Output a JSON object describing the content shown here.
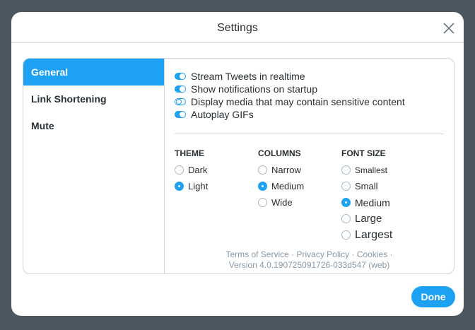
{
  "title": "Settings",
  "sidebar": {
    "items": [
      {
        "label": "General",
        "active": true
      },
      {
        "label": "Link Shortening"
      },
      {
        "label": "Mute"
      }
    ]
  },
  "toggles": [
    {
      "label": "Stream Tweets in realtime",
      "on": true
    },
    {
      "label": "Show notifications on startup",
      "on": true
    },
    {
      "label": "Display media that may contain sensitive content",
      "on": false
    },
    {
      "label": "Autoplay GIFs",
      "on": true
    }
  ],
  "theme": {
    "heading": "THEME",
    "options": [
      "Dark",
      "Light"
    ],
    "selected": "Light"
  },
  "columns": {
    "heading": "COLUMNS",
    "options": [
      "Narrow",
      "Medium",
      "Wide"
    ],
    "selected": "Medium"
  },
  "font_size": {
    "heading": "FONT SIZE",
    "options": [
      "Smallest",
      "Small",
      "Medium",
      "Large",
      "Largest"
    ],
    "selected": "Medium"
  },
  "footer": {
    "terms": "Terms of Service",
    "privacy": "Privacy Policy",
    "cookies": "Cookies",
    "sep": " · ",
    "version": "Version 4.0.190725091726-033d547 (web)"
  },
  "done_label": "Done"
}
